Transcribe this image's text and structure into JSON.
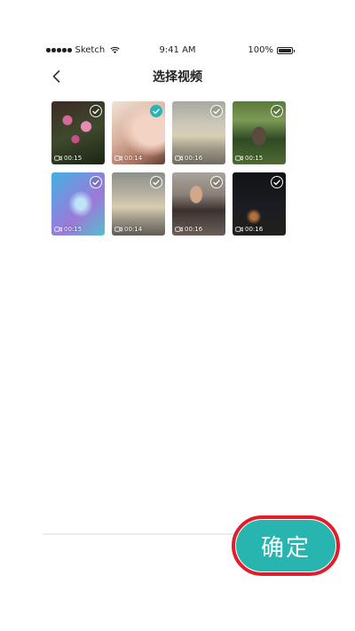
{
  "status_bar": {
    "carrier": "Sketch",
    "time": "9:41 AM",
    "battery": "100%"
  },
  "nav": {
    "title": "选择视频"
  },
  "videos": [
    {
      "duration": "00:15",
      "selected": false
    },
    {
      "duration": "00:14",
      "selected": true
    },
    {
      "duration": "00:16",
      "selected": false
    },
    {
      "duration": "00:15",
      "selected": false
    },
    {
      "duration": "00:15",
      "selected": false
    },
    {
      "duration": "00:14",
      "selected": false
    },
    {
      "duration": "00:16",
      "selected": false
    },
    {
      "duration": "00:16",
      "selected": false
    }
  ],
  "confirm_button": {
    "label": "确定"
  },
  "colors": {
    "accent": "#28b5b0",
    "highlight_ring": "#e21d2b"
  }
}
